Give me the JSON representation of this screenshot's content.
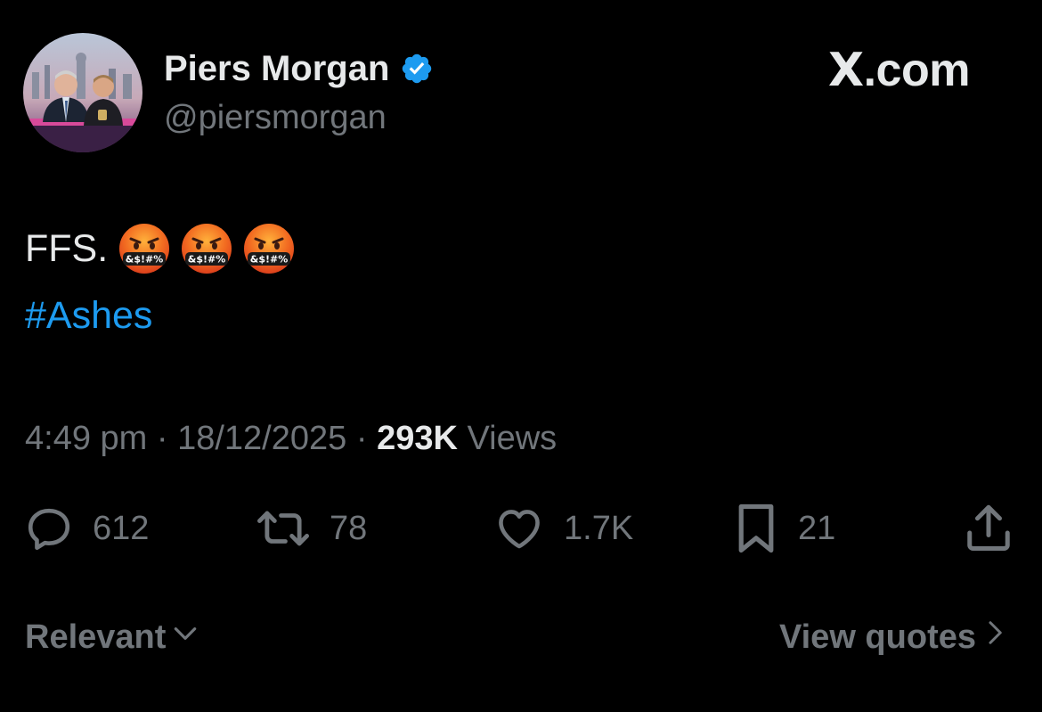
{
  "author": {
    "display_name": "Piers Morgan",
    "handle": "@piersmorgan",
    "verified": true,
    "verified_color": "#1d9bf0"
  },
  "source_logo": "X.com",
  "tweet": {
    "text": "FFS.",
    "emojis": [
      "face-with-symbols-on-mouth",
      "face-with-symbols-on-mouth",
      "face-with-symbols-on-mouth"
    ],
    "hashtag": "#Ashes",
    "hashtag_color": "#1d9bf0"
  },
  "meta": {
    "time": "4:49 pm",
    "separator": "·",
    "date": "18/12/2025",
    "views_count": "293K",
    "views_label": "Views"
  },
  "actions": {
    "replies": "612",
    "reposts": "78",
    "likes": "1.7K",
    "bookmarks": "21"
  },
  "footer": {
    "sort_label": "Relevant",
    "view_quotes_label": "View quotes"
  },
  "colors": {
    "background": "#000000",
    "primary_text": "#e7e9ea",
    "secondary_text": "#71767b",
    "accent": "#1d9bf0"
  }
}
